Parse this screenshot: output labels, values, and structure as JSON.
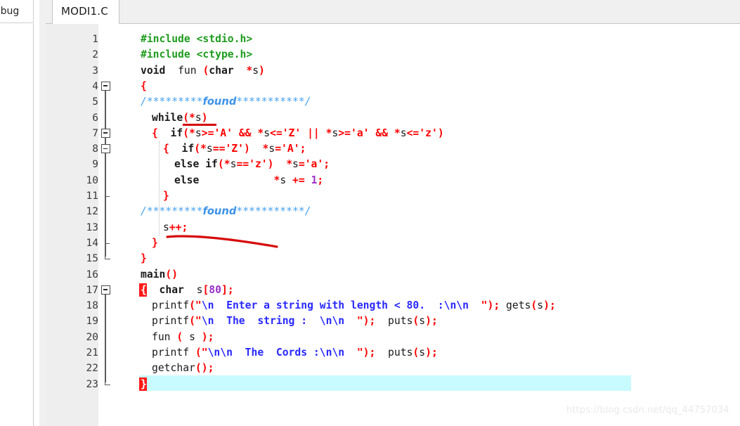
{
  "left_panel": {
    "tab_label": "ebug"
  },
  "editor": {
    "tab_label": "MODI1.C",
    "first_line_number": 1,
    "total_lines": 23,
    "selected_line": 23,
    "colors": {
      "preprocessor": "#1f9c1f",
      "punctuation": "#ff0000",
      "string": "#2929ff",
      "number": "#9b30c8",
      "comment": "#4aa3ef",
      "selection": "#c8fbff",
      "brace_match": "#ff1a1a",
      "annotation": "#d60b0b",
      "gutter_bg": "#eeeeee"
    },
    "lines": [
      {
        "n": "1",
        "indent": 0,
        "fold": "none",
        "text": "#include <stdio.h>"
      },
      {
        "n": "2",
        "indent": 0,
        "fold": "none",
        "text": "#include <ctype.h>"
      },
      {
        "n": "3",
        "indent": 0,
        "fold": "none",
        "text": "void  fun (char  *s)"
      },
      {
        "n": "4",
        "indent": 0,
        "fold": "box",
        "text": "{"
      },
      {
        "n": "5",
        "indent": 0,
        "fold": "line",
        "text": "/*********found***********/"
      },
      {
        "n": "6",
        "indent": 1,
        "fold": "line",
        "text": "while(*s)"
      },
      {
        "n": "7",
        "indent": 1,
        "fold": "box",
        "text": "{  if(*s>='A' && *s<='Z' || *s>='a' && *s<='z')"
      },
      {
        "n": "8",
        "indent": 2,
        "fold": "box",
        "text": "{  if(*s=='Z')  *s='A';"
      },
      {
        "n": "9",
        "indent": 3,
        "fold": "line",
        "text": "else if(*s=='z')  *s='a';"
      },
      {
        "n": "10",
        "indent": 3,
        "fold": "line",
        "text": "else            *s += 1;"
      },
      {
        "n": "11",
        "indent": 2,
        "fold": "tick",
        "text": "}"
      },
      {
        "n": "12",
        "indent": 0,
        "fold": "line",
        "text": "/*********found***********/"
      },
      {
        "n": "13",
        "indent": 2,
        "fold": "line",
        "text": "s++;"
      },
      {
        "n": "14",
        "indent": 1,
        "fold": "tick",
        "text": "}"
      },
      {
        "n": "15",
        "indent": 0,
        "fold": "end",
        "text": "}"
      },
      {
        "n": "16",
        "indent": 0,
        "fold": "none",
        "text": "main()"
      },
      {
        "n": "17",
        "indent": 0,
        "fold": "box",
        "text": "{  char  s[80];"
      },
      {
        "n": "18",
        "indent": 1,
        "fold": "line",
        "text": "printf(\"\\n  Enter a string with length < 80.  :\\n\\n  \"); gets(s);"
      },
      {
        "n": "19",
        "indent": 1,
        "fold": "line",
        "text": "printf(\"\\n  The  string :  \\n\\n  \");  puts(s);"
      },
      {
        "n": "20",
        "indent": 1,
        "fold": "line",
        "text": "fun ( s );"
      },
      {
        "n": "21",
        "indent": 1,
        "fold": "line",
        "text": "printf (\"\\n\\n  The  Cords :\\n\\n  \");  puts(s);"
      },
      {
        "n": "22",
        "indent": 1,
        "fold": "line",
        "text": "getchar();"
      },
      {
        "n": "23",
        "indent": 0,
        "fold": "end",
        "text": "}"
      }
    ],
    "comment_text": "/*********found***********/",
    "comment_prefix": "/*********",
    "comment_word": "found",
    "comment_suffix": "***********/",
    "annotations": [
      {
        "name": "underline-while-deref",
        "note": "red underline below (*s) on line 6"
      },
      {
        "name": "underline-s-increment",
        "note": "red curved underline below s++; on line 13"
      }
    ]
  },
  "watermark": {
    "text": "https://blog.csdn.net/qq_44757034"
  }
}
